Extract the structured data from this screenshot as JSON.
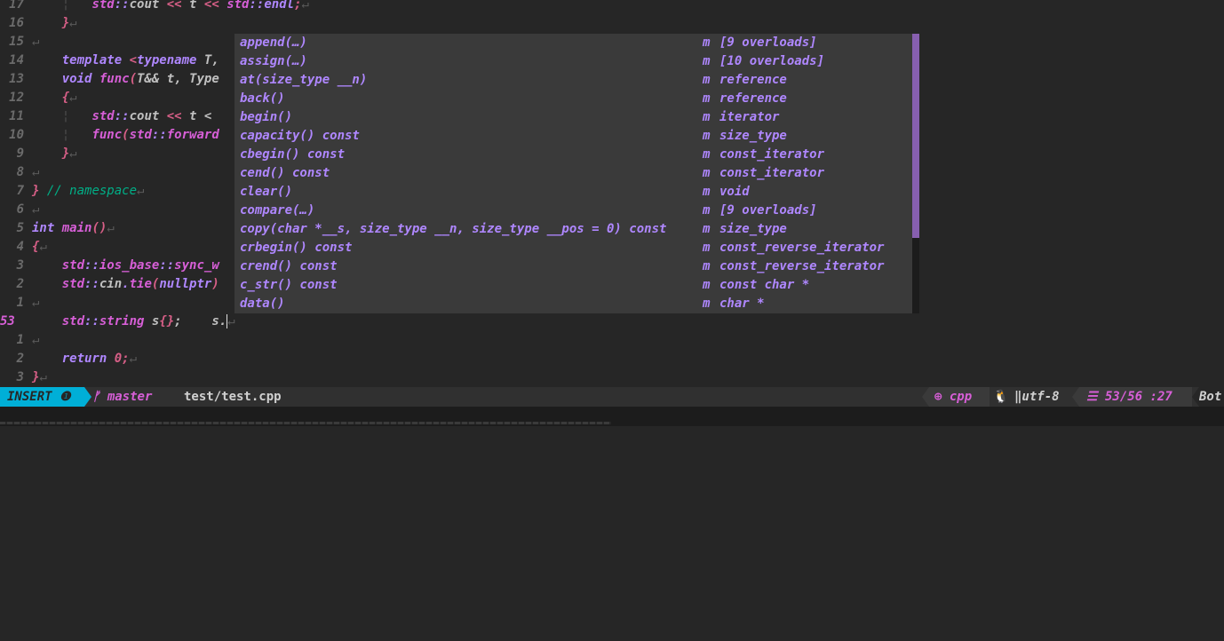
{
  "editor": {
    "lines": [
      {
        "num": "17",
        "html": "<span class=\"guide\">    ¦   </span><span class=\"f\">std</span><span class=\"k\">::</span><span class=\"t\">cout </span><span class=\"p\">&lt;&lt;</span><span class=\"t\"> t </span><span class=\"p\">&lt;&lt;</span><span class=\"t\"> </span><span class=\"f\">std</span><span class=\"k\">::endl</span><span class=\"p\">;</span><span class=\"nl\">↵</span>"
      },
      {
        "num": "16",
        "html": "<span class=\"guide\">    </span><span class=\"p\">}</span><span class=\"nl\">↵</span>"
      },
      {
        "num": "15",
        "html": "<span class=\"nl\">↵</span>"
      },
      {
        "num": "14",
        "html": "<span class=\"t\">    </span><span class=\"k\">template </span><span class=\"p\">&lt;</span><span class=\"k\">typename</span><span class=\"t\"> T,</span>"
      },
      {
        "num": "13",
        "html": "<span class=\"t\">    </span><span class=\"k\">void</span><span class=\"t\"> </span><span class=\"f\">func</span><span class=\"p\">(</span><span class=\"t\">T&amp;&amp; t, Type</span>"
      },
      {
        "num": "12",
        "html": "<span class=\"t\">    </span><span class=\"p\">{</span><span class=\"nl\">↵</span>"
      },
      {
        "num": "11",
        "html": "<span class=\"guide\">    ¦   </span><span class=\"f\">std</span><span class=\"k\">::</span><span class=\"t\">cout </span><span class=\"p\">&lt;&lt;</span><span class=\"t\"> t &lt;</span>"
      },
      {
        "num": "10",
        "html": "<span class=\"guide\">    ¦   </span><span class=\"f\">func</span><span class=\"p\">(</span><span class=\"f\">std</span><span class=\"k\">::</span><span class=\"f\">forward</span>"
      },
      {
        "num": "9",
        "html": "<span class=\"guide\">    </span><span class=\"p\">}</span><span class=\"nl\">↵</span>"
      },
      {
        "num": "8",
        "html": "<span class=\"nl\">↵</span>"
      },
      {
        "num": "7",
        "html": "<span class=\"p\">}</span><span class=\"c\"> // namespace</span><span class=\"nl\">↵</span>"
      },
      {
        "num": "6",
        "html": "<span class=\"nl\">↵</span>"
      },
      {
        "num": "5",
        "html": "<span class=\"k\">int</span><span class=\"t\"> </span><span class=\"f\">main</span><span class=\"p\">()</span><span class=\"nl\">↵</span>"
      },
      {
        "num": "4",
        "html": "<span class=\"p\">{</span><span class=\"nl\">↵</span>"
      },
      {
        "num": "3",
        "html": "<span class=\"t\">    </span><span class=\"f\">std</span><span class=\"k\">::</span><span class=\"f\">ios_base</span><span class=\"k\">::</span><span class=\"f\">sync_w</span>"
      },
      {
        "num": "2",
        "html": "<span class=\"t\">    </span><span class=\"f\">std</span><span class=\"k\">::</span><span class=\"t\">cin</span><span class=\"k\">.</span><span class=\"f\">tie</span><span class=\"p\">(</span><span class=\"k\">nullptr</span><span class=\"p\">)</span>"
      },
      {
        "num": "1",
        "html": "<span class=\"nl\">↵</span>"
      },
      {
        "num": "53",
        "cur": true,
        "html": "<span class=\"t\">    </span><span class=\"f\">std</span><span class=\"k\">::</span><span class=\"f\">string</span><span class=\"t\"> s</span><span class=\"p\">{}</span><span class=\"t\">;    s.</span><span class=\"cursor\"></span><span class=\"nl\">↵</span>"
      },
      {
        "num": "1",
        "html": "<span class=\"nl\">↵</span>"
      },
      {
        "num": "2",
        "html": "<span class=\"t\">    </span><span class=\"k\">return</span><span class=\"t\"> </span><span class=\"p\">0;</span><span class=\"nl\">↵</span>"
      },
      {
        "num": "3",
        "html": "<span class=\"p\">}</span><span class=\"nl\">↵</span>"
      }
    ]
  },
  "completion": {
    "items": [
      {
        "word": "append(…)",
        "kind": "m",
        "menu": "[9 overloads]"
      },
      {
        "word": "assign(…)",
        "kind": "m",
        "menu": "[10 overloads]"
      },
      {
        "word": "at(size_type __n)",
        "kind": "m",
        "menu": "reference"
      },
      {
        "word": "back()",
        "kind": "m",
        "menu": "reference"
      },
      {
        "word": "begin()",
        "kind": "m",
        "menu": "iterator"
      },
      {
        "word": "capacity() const",
        "kind": "m",
        "menu": "size_type"
      },
      {
        "word": "cbegin() const",
        "kind": "m",
        "menu": "const_iterator"
      },
      {
        "word": "cend() const",
        "kind": "m",
        "menu": "const_iterator"
      },
      {
        "word": "clear()",
        "kind": "m",
        "menu": "void"
      },
      {
        "word": "compare(…)",
        "kind": "m",
        "menu": "[9 overloads]"
      },
      {
        "word": "copy(char *__s, size_type __n, size_type __pos = 0) const",
        "kind": "m",
        "menu": "size_type"
      },
      {
        "word": "crbegin() const",
        "kind": "m",
        "menu": "const_reverse_iterator"
      },
      {
        "word": "crend() const",
        "kind": "m",
        "menu": "const_reverse_iterator"
      },
      {
        "word": "c_str() const",
        "kind": "m",
        "menu": "const char *"
      },
      {
        "word": "data()",
        "kind": "m",
        "menu": "char *"
      }
    ]
  },
  "statusline": {
    "mode": "INSERT ❶",
    "branch": "ᚠ master",
    "filename": "test/test.cpp",
    "filetype": "⊕ cpp",
    "os_icon": "🐧",
    "encoding": "‖utf-8",
    "position": "☰ 53/56 :27",
    "scroll": "Bot"
  }
}
